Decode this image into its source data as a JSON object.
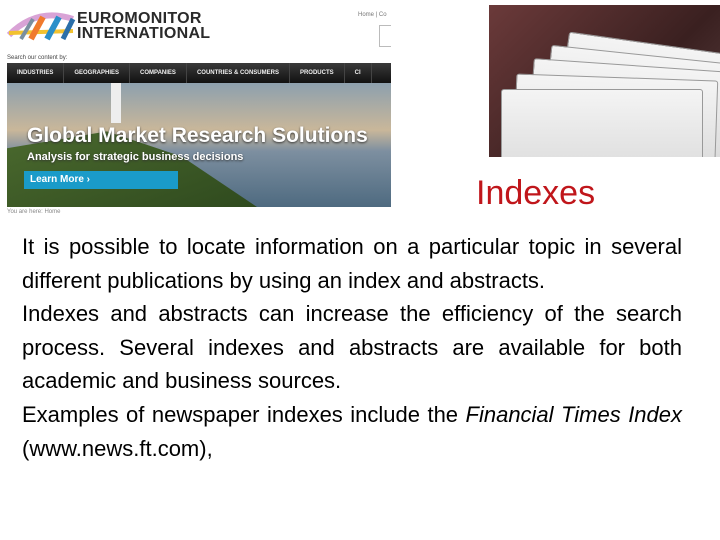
{
  "screenshot": {
    "brand_line1": "EUROMONITOR",
    "brand_line2": "INTERNATIONAL",
    "top_links": "Home | Co",
    "search_by": "Search our content by:",
    "nav": [
      "INDUSTRIES",
      "GEOGRAPHIES",
      "COMPANIES",
      "COUNTRIES & CONSUMERS",
      "PRODUCTS",
      "CI"
    ],
    "hero_title": "Global Market Research Solutions",
    "hero_subtitle": "Analysis for strategic business decisions",
    "learn_more": "Learn More ›",
    "breadcrumb": "You are here: Home"
  },
  "title": "Indexes",
  "title_color": "#c0161b",
  "body": {
    "p1": "It is possible to locate information on a particular topic in several different publications by using an index and abstracts.",
    "p2": "Indexes and abstracts can increase the efficiency of the search process. Several indexes and abstracts are available for both academic and business sources.",
    "p3_before": "Examples of newspaper indexes include the ",
    "p3_italic": "Financial Times Index",
    "p3_after": " (www.news.ft.com),"
  }
}
